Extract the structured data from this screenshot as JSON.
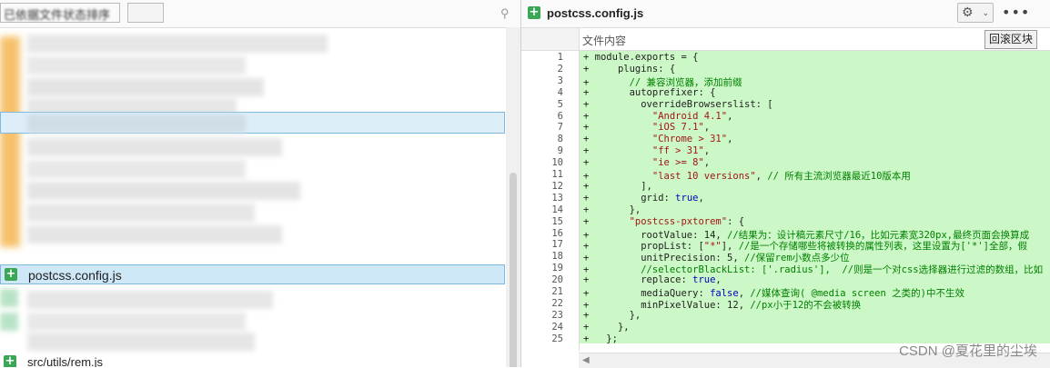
{
  "left_panel": {
    "header_title": "已依据文件状态排序",
    "highlighted_file": "postcss.config.js",
    "last_file": "src/utils/rem.js"
  },
  "editor": {
    "file_name": "postcss.config.js",
    "content_label": "文件内容",
    "rollback_button": "回滚区块",
    "line_numbers": [
      "1",
      "2",
      "3",
      "4",
      "5",
      "6",
      "7",
      "8",
      "9",
      "10",
      "11",
      "12",
      "13",
      "14",
      "15",
      "16",
      "17",
      "18",
      "19",
      "20",
      "21",
      "22",
      "23",
      "24",
      "25"
    ],
    "lines": [
      "module.exports = {",
      "    plugins: {",
      "      // 兼容浏览器，添加前缀",
      "      autoprefixer: {",
      "        overrideBrowserslist: [",
      "          \"Android 4.1\",",
      "          \"iOS 7.1\",",
      "          \"Chrome > 31\",",
      "          \"ff > 31\",",
      "          \"ie >= 8\",",
      "          \"last 10 versions\", // 所有主流浏览器最近10版本用",
      "        ],",
      "        grid: true,",
      "      },",
      "      \"postcss-pxtorem\": {",
      "        rootValue: 14, //结果为：设计稿元素尺寸/16，比如元素宽320px,最终页面会换算成",
      "        propList: [\"*\"], //是一个存储哪些将被转换的属性列表，这里设置为['*']全部，假",
      "        unitPrecision: 5, //保留rem小数点多少位",
      "        //selectorBlackList: ['.radius'],  //则是一个对css选择器进行过滤的数组，比如",
      "        replace: true,",
      "        mediaQuery: false, //媒体查询( @media screen 之类的)中不生效",
      "        minPixelValue: 12, //px小于12的不会被转换",
      "      },",
      "    },",
      "  };"
    ]
  },
  "watermark": "CSDN @夏花里的尘埃",
  "icons": [
    "search-icon",
    "plus-icon",
    "gear-icon",
    "chevron-down-icon",
    "more-icon"
  ]
}
